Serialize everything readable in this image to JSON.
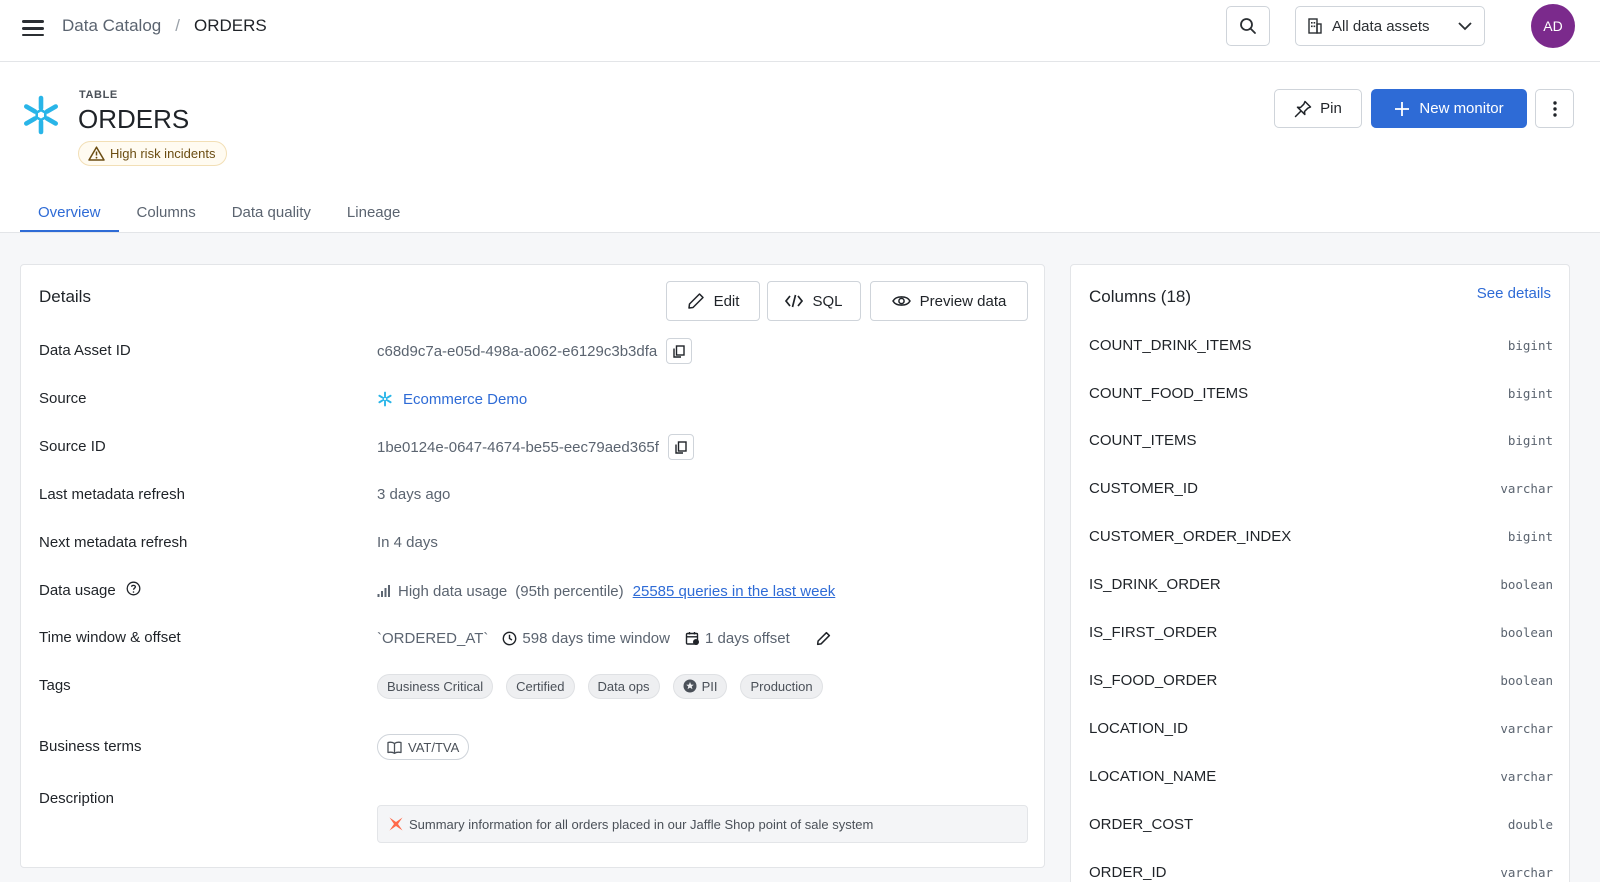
{
  "topbar": {
    "breadcrumb_parent": "Data Catalog",
    "breadcrumb_sep": "/",
    "breadcrumb_current": "ORDERS",
    "asset_filter": "All data assets",
    "avatar_initials": "AD"
  },
  "header": {
    "type_label": "TABLE",
    "title": "ORDERS",
    "risk_badge": "High risk incidents",
    "pin_label": "Pin",
    "new_monitor_label": "New monitor"
  },
  "tabs": [
    {
      "label": "Overview",
      "active": true
    },
    {
      "label": "Columns",
      "active": false
    },
    {
      "label": "Data quality",
      "active": false
    },
    {
      "label": "Lineage",
      "active": false
    }
  ],
  "details": {
    "title": "Details",
    "edit_label": "Edit",
    "sql_label": "SQL",
    "preview_label": "Preview data",
    "data_asset_id_label": "Data Asset ID",
    "data_asset_id": "c68d9c7a-e05d-498a-a062-e6129c3b3dfa",
    "source_label": "Source",
    "source": "Ecommerce Demo",
    "source_id_label": "Source ID",
    "source_id": "1be0124e-0647-4674-be55-eec79aed365f",
    "last_refresh_label": "Last metadata refresh",
    "last_refresh": "3 days ago",
    "next_refresh_label": "Next metadata refresh",
    "next_refresh": "In 4 days",
    "data_usage_label": "Data usage",
    "data_usage": "High data usage",
    "data_usage_percentile": "(95th percentile)",
    "data_usage_queries": "25585 queries in the last week",
    "time_window_label": "Time window & offset",
    "time_column": "`ORDERED_AT`",
    "time_window": "598 days time window",
    "time_offset": "1 days offset",
    "tags_label": "Tags",
    "tags": [
      "Business Critical",
      "Certified",
      "Data ops",
      "PII",
      "Production"
    ],
    "business_terms_label": "Business terms",
    "business_term": "VAT/TVA",
    "description_label": "Description",
    "description": "Summary information for all orders placed in our Jaffle Shop point of sale system"
  },
  "columns_panel": {
    "title": "Columns (18)",
    "see_details": "See details",
    "columns": [
      {
        "name": "COUNT_DRINK_ITEMS",
        "type": "bigint"
      },
      {
        "name": "COUNT_FOOD_ITEMS",
        "type": "bigint"
      },
      {
        "name": "COUNT_ITEMS",
        "type": "bigint"
      },
      {
        "name": "CUSTOMER_ID",
        "type": "varchar"
      },
      {
        "name": "CUSTOMER_ORDER_INDEX",
        "type": "bigint"
      },
      {
        "name": "IS_DRINK_ORDER",
        "type": "boolean"
      },
      {
        "name": "IS_FIRST_ORDER",
        "type": "boolean"
      },
      {
        "name": "IS_FOOD_ORDER",
        "type": "boolean"
      },
      {
        "name": "LOCATION_ID",
        "type": "varchar"
      },
      {
        "name": "LOCATION_NAME",
        "type": "varchar"
      },
      {
        "name": "ORDER_COST",
        "type": "double"
      },
      {
        "name": "ORDER_ID",
        "type": "varchar"
      }
    ]
  },
  "colors": {
    "accent": "#2e6bd6",
    "avatar": "#7b2a8c",
    "snowflake": "#29b5e8",
    "warning": "#6b4d12"
  },
  "icons": [
    "menu-icon",
    "search-icon",
    "building-icon",
    "chevron-down-icon",
    "snowflake-icon",
    "warning-icon",
    "pin-icon",
    "plus-icon",
    "more-vertical-icon",
    "pencil-icon",
    "code-icon",
    "eye-icon",
    "copy-icon",
    "help-icon",
    "signal-icon",
    "clock-icon",
    "calendar-icon",
    "star-icon",
    "book-icon",
    "dbt-icon"
  ]
}
